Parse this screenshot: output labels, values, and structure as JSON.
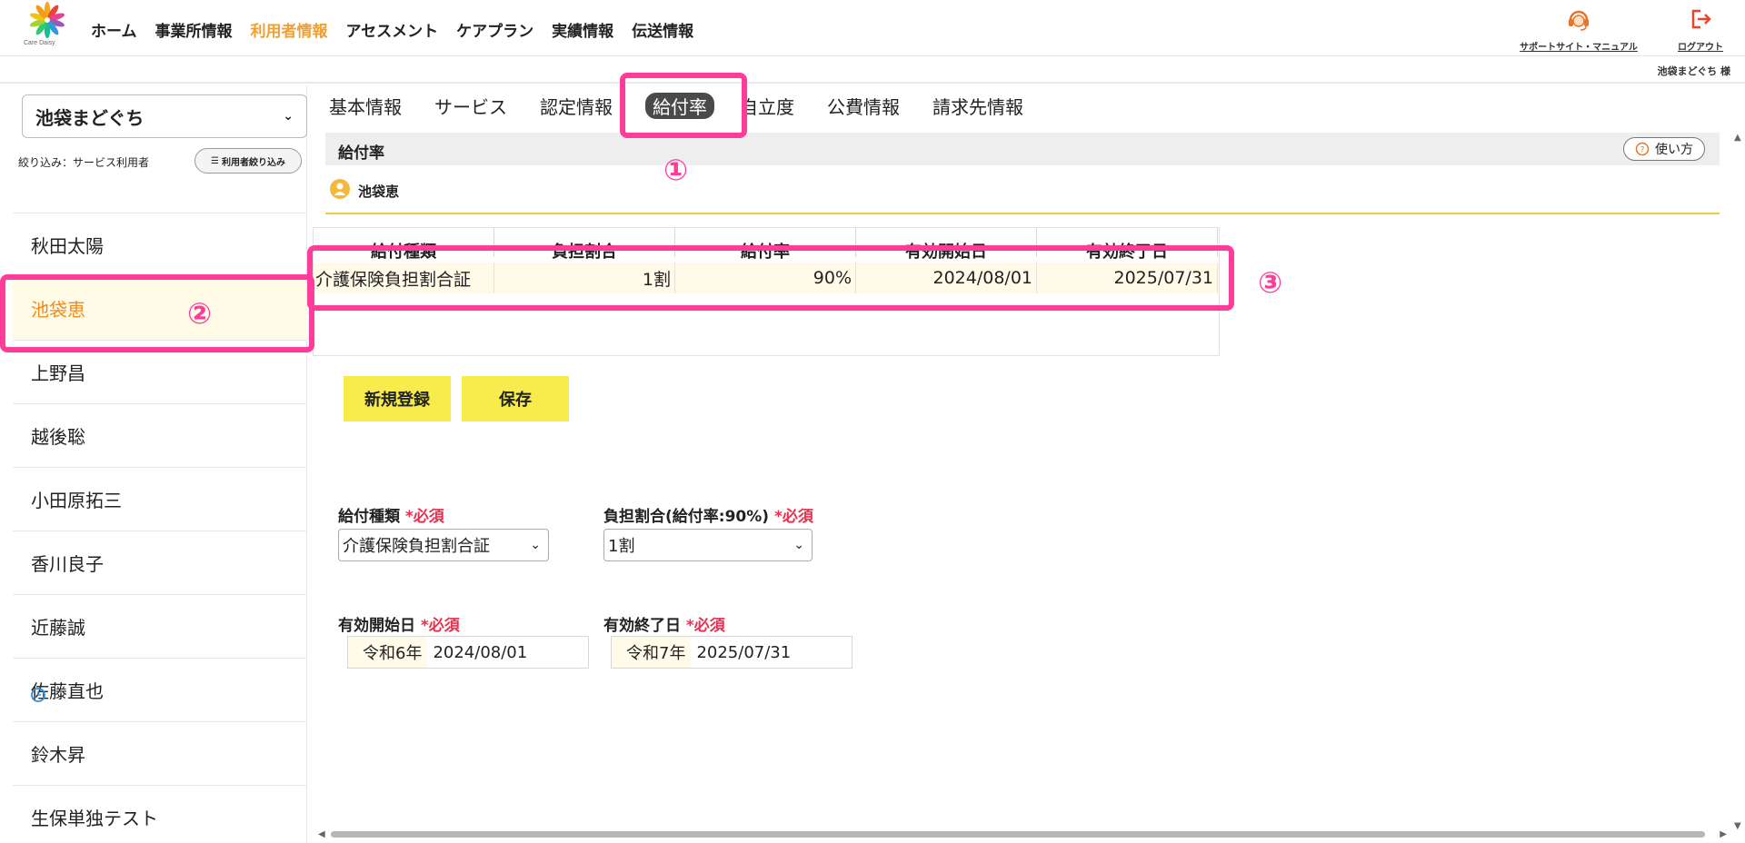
{
  "header": {
    "logo_text": "Care Daisy",
    "nav": [
      "ホーム",
      "事業所情報",
      "利用者情報",
      "アセスメント",
      "ケアプラン",
      "実績情報",
      "伝送情報"
    ],
    "nav_active_index": 2,
    "support_label": "サポートサイト・マニュアル",
    "logout_label": "ログアウト",
    "user_name": "池袋まどぐち 様"
  },
  "sidebar": {
    "selected_office": "池袋まどぐち",
    "filter_label": "絞り込み：サービス利用者",
    "filter_button": "利用者絞り込み",
    "items": [
      "秋田太陽",
      "池袋恵",
      "上野昌",
      "越後聡",
      "小田原拓三",
      "香川良子",
      "近藤誠",
      "佐藤直也",
      "鈴木昇",
      "生保単独テスト"
    ],
    "selected_index": 1
  },
  "tabs": [
    "基本情報",
    "サービス",
    "認定情報",
    "給付率",
    "自立度",
    "公費情報",
    "請求先情報"
  ],
  "tabs_active_index": 3,
  "section": {
    "title": "給付率",
    "help_label": "使い方",
    "client_name": "池袋恵"
  },
  "table": {
    "headers": [
      "給付種類",
      "負担割合",
      "給付率",
      "有効開始日",
      "有効終了日"
    ],
    "rows": [
      [
        "介護保険負担割合証",
        "1割",
        "90%",
        "2024/08/01",
        "2025/07/31"
      ]
    ]
  },
  "buttons": {
    "new_label": "新規登録",
    "save_label": "保存"
  },
  "form": {
    "type_label": "給付種類",
    "type_required": "*必須",
    "type_value": "介護保険負担割合証",
    "ratio_label": "負担割合(給付率:90%)",
    "ratio_required": "*必須",
    "ratio_value": "1割",
    "start_label": "有効開始日",
    "start_required": "*必須",
    "start_era": "令和6年",
    "start_value": "2024/08/01",
    "end_label": "有効終了日",
    "end_required": "*必須",
    "end_era": "令和7年",
    "end_value": "2025/07/31"
  },
  "annotations": [
    "①",
    "②",
    "③"
  ],
  "colors": {
    "accent_orange": "#f0a033",
    "annotation_pink": "#ff3c9a",
    "button_yellow": "#f8ec4c",
    "required_red": "#e83050"
  }
}
